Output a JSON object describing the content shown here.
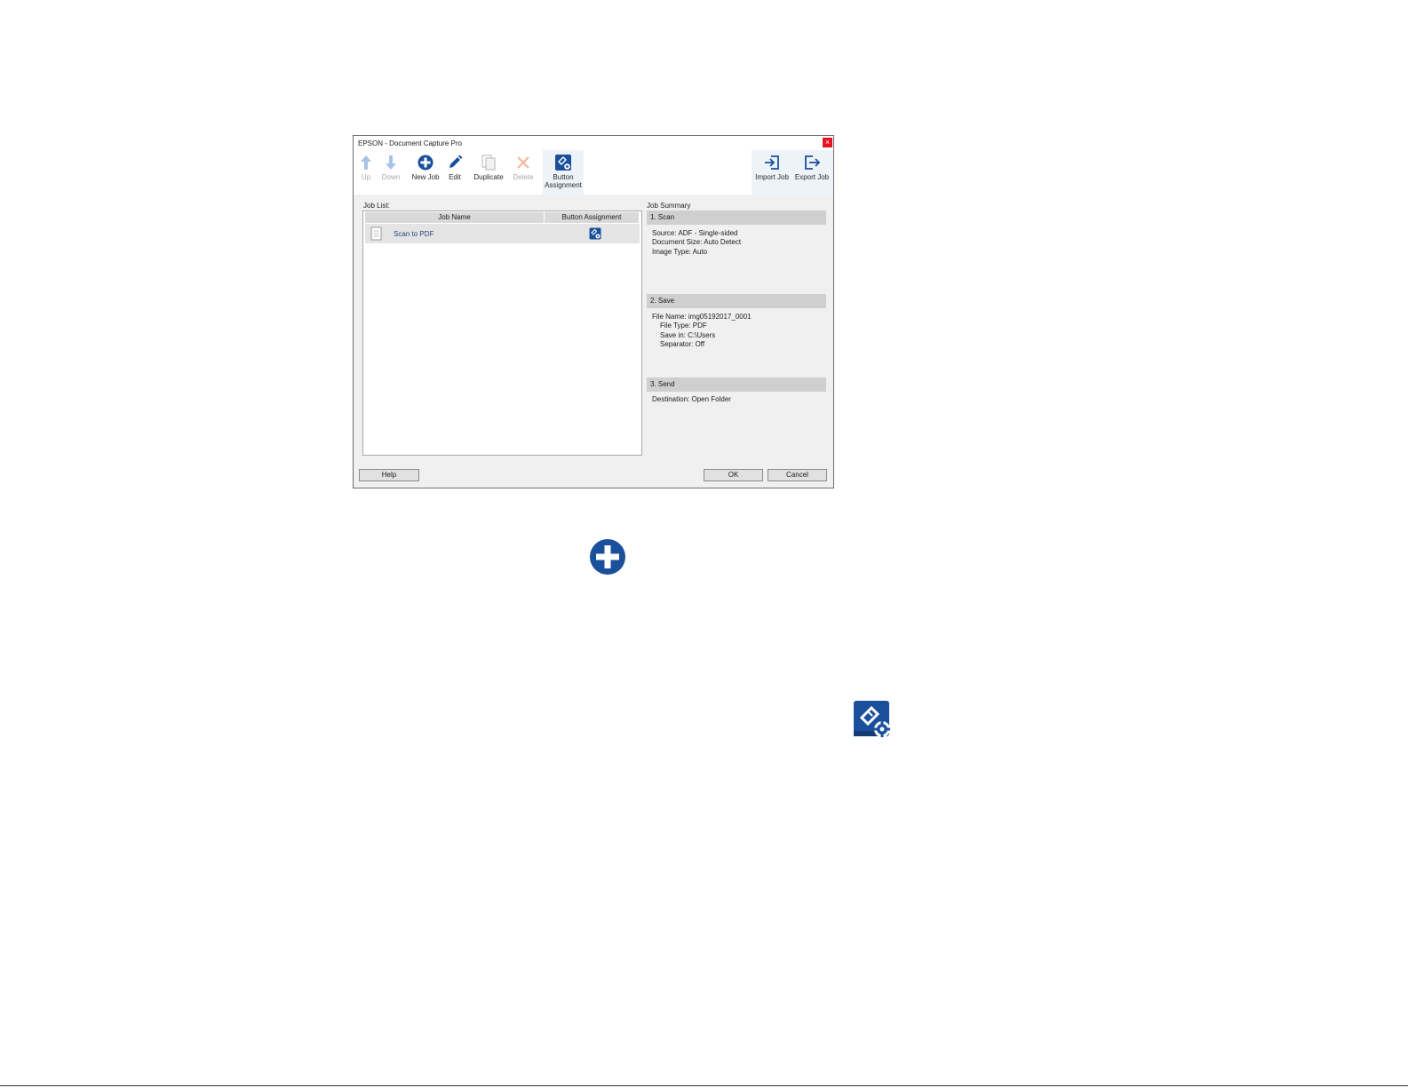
{
  "window": {
    "title": "EPSON - Document Capture Pro",
    "close_glyph": "×"
  },
  "toolbar": {
    "up": "Up",
    "down": "Down",
    "new_job": "New Job",
    "edit": "Edit",
    "duplicate": "Duplicate",
    "delete": "Delete",
    "button_assignment_1": "Button",
    "button_assignment_2": "Assignment",
    "import_job": "Import Job",
    "export_job": "Export Job"
  },
  "job_list": {
    "label": "Job List:",
    "columns": [
      "Job Name",
      "Button Assignment"
    ],
    "rows": [
      {
        "name": "Scan to PDF",
        "assignment_icon": "button-assignment-icon"
      }
    ]
  },
  "summary": {
    "label": "Job Summary",
    "scan": {
      "header": "1. Scan",
      "lines": [
        "Source: ADF - Single-sided",
        "Document Size: Auto Detect",
        "Image Type: Auto"
      ]
    },
    "save": {
      "header": "2. Save",
      "lines": [
        "File Name: img05192017_0001",
        "File Type: PDF",
        "Save in: C:\\Users",
        "Separator: Off"
      ]
    },
    "send": {
      "header": "3. Send",
      "lines": [
        "Destination: Open Folder"
      ]
    }
  },
  "buttons": {
    "help": "Help",
    "ok": "OK",
    "cancel": "Cancel"
  },
  "icons": {
    "new_job_standalone": "plus-circle-icon",
    "button_assignment_standalone": "button-assignment-icon"
  },
  "colors": {
    "accent": "#1a4f9c",
    "disabled": "#a8c2e6",
    "close": "#e81123"
  }
}
